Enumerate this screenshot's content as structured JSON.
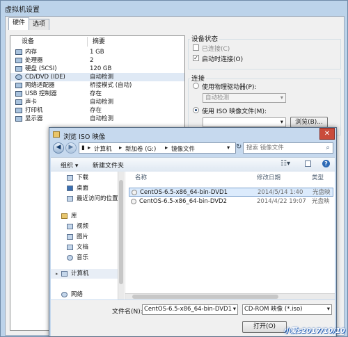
{
  "vm_window": {
    "title": "虚拟机设置",
    "tabs": [
      {
        "label": "硬件"
      },
      {
        "label": "选项"
      }
    ],
    "device_columns": {
      "device": "设备",
      "summary": "摘要"
    },
    "devices": [
      {
        "name": "内存",
        "summary": "1 GB",
        "icon": "memory-icon"
      },
      {
        "name": "处理器",
        "summary": "2",
        "icon": "cpu-icon"
      },
      {
        "name": "硬盘 (SCSI)",
        "summary": "120 GB",
        "icon": "hard-disk-icon"
      },
      {
        "name": "CD/DVD (IDE)",
        "summary": "自动检测",
        "icon": "cd-dvd-icon",
        "selected": true
      },
      {
        "name": "网络适配器",
        "summary": "桥接模式 (自动)",
        "icon": "network-adapter-icon"
      },
      {
        "name": "USB 控制器",
        "summary": "存在",
        "icon": "usb-icon"
      },
      {
        "name": "声卡",
        "summary": "自动检测",
        "icon": "sound-card-icon"
      },
      {
        "name": "打印机",
        "summary": "存在",
        "icon": "printer-icon"
      },
      {
        "name": "显示器",
        "summary": "自动检测",
        "icon": "display-icon"
      }
    ],
    "device_status": {
      "title": "设备状态",
      "connected_label": "已连接(C)",
      "connected_checked": false,
      "connect_on_power_label": "启动时连接(O)",
      "connect_on_power_checked": true
    },
    "connection": {
      "title": "连接",
      "physical_label": "使用物理驱动器(P):",
      "physical_value": "自动检测",
      "iso_label": "使用 ISO 映像文件(M):",
      "iso_value": "",
      "browse_label": "浏览(B)...",
      "selected": "iso"
    }
  },
  "iso_dialog": {
    "title": "浏览 ISO 映像",
    "close_glyph": "✕",
    "breadcrumb": [
      {
        "label": "计算机"
      },
      {
        "label": "新加卷 (G:)"
      },
      {
        "label": "镜像文件"
      }
    ],
    "breadcrumb_sep": "▸",
    "search_placeholder": "搜索 镜像文件",
    "toolbar": {
      "organize": "组织 ▾",
      "new_folder": "新建文件夹"
    },
    "nav": {
      "favorites": [
        {
          "label": "下载",
          "icon": "download-folder-icon"
        },
        {
          "label": "桌面",
          "icon": "desktop-icon"
        },
        {
          "label": "最近访问的位置",
          "icon": "recent-places-icon"
        }
      ],
      "library": {
        "label": "库",
        "icon": "library-icon"
      },
      "library_items": [
        {
          "label": "视频",
          "icon": "videos-icon"
        },
        {
          "label": "图片",
          "icon": "pictures-icon"
        },
        {
          "label": "文档",
          "icon": "documents-icon"
        },
        {
          "label": "音乐",
          "icon": "music-icon"
        }
      ],
      "computer": {
        "label": "计算机",
        "icon": "computer-icon"
      },
      "network": {
        "label": "网络",
        "icon": "network-icon"
      }
    },
    "columns": {
      "name": "名称",
      "modified": "修改日期",
      "type": "类型"
    },
    "files": [
      {
        "name": "CentOS-6.5-x86_64-bin-DVD1",
        "modified": "2014/5/14 1:40",
        "type": "光盘映",
        "selected": true
      },
      {
        "name": "CentOS-6.5-x86_64-bin-DVD2",
        "modified": "2014/4/22 19:07",
        "type": "光盘映",
        "selected": false
      }
    ],
    "filename_label": "文件名(N):",
    "filename_value": "CentOS-6.5-x86_64-bin-DVD1",
    "filetype_value": "CD-ROM 映像 (*.iso)",
    "open_label": "打开(O)"
  },
  "watermark": "小爱s2017/10/10"
}
